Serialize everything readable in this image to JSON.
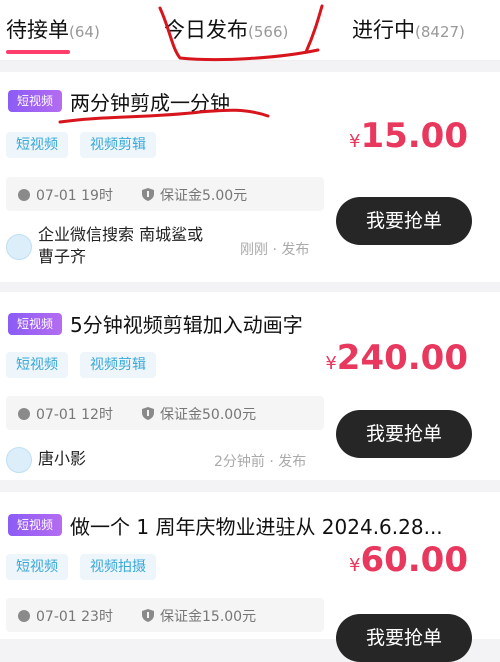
{
  "tabs": [
    {
      "label": "待接单",
      "count": "(64)"
    },
    {
      "label": "今日发布",
      "count": "(566)"
    },
    {
      "label": "进行中",
      "count": "(8427)"
    }
  ],
  "orders": [
    {
      "badge": "短视频",
      "title": "两分钟剪成一分钟",
      "tags": [
        "短视频",
        "视频剪辑"
      ],
      "currency": "¥",
      "price": "15.00",
      "date": "07-01 19时",
      "deposit": "保证金5.00元",
      "grab_label": "我要抢单",
      "publisher": "企业微信搜索 南城鲨或 曹子齐",
      "publish_time": "刚刚 · 发布"
    },
    {
      "badge": "短视频",
      "title": "5分钟视频剪辑加入动画字",
      "tags": [
        "短视频",
        "视频剪辑"
      ],
      "currency": "¥",
      "price": "240.00",
      "date": "07-01 12时",
      "deposit": "保证金50.00元",
      "grab_label": "我要抢单",
      "publisher": "唐小影",
      "publish_time": "2分钟前 · 发布"
    },
    {
      "badge": "短视频",
      "title": "做一个 1 周年庆物业进驻从 2024.6.28...",
      "tags": [
        "短视频",
        "视频拍摄"
      ],
      "currency": "¥",
      "price": "60.00",
      "date": "07-01 23时",
      "deposit": "保证金15.00元",
      "grab_label": "我要抢单"
    }
  ],
  "colors": {
    "accent": "#ff3e6c",
    "price": "#e8385e",
    "badge": "#8b5cf6",
    "tag_text": "#3aa8d8",
    "button": "#262626",
    "annotation": "#d8141c"
  }
}
